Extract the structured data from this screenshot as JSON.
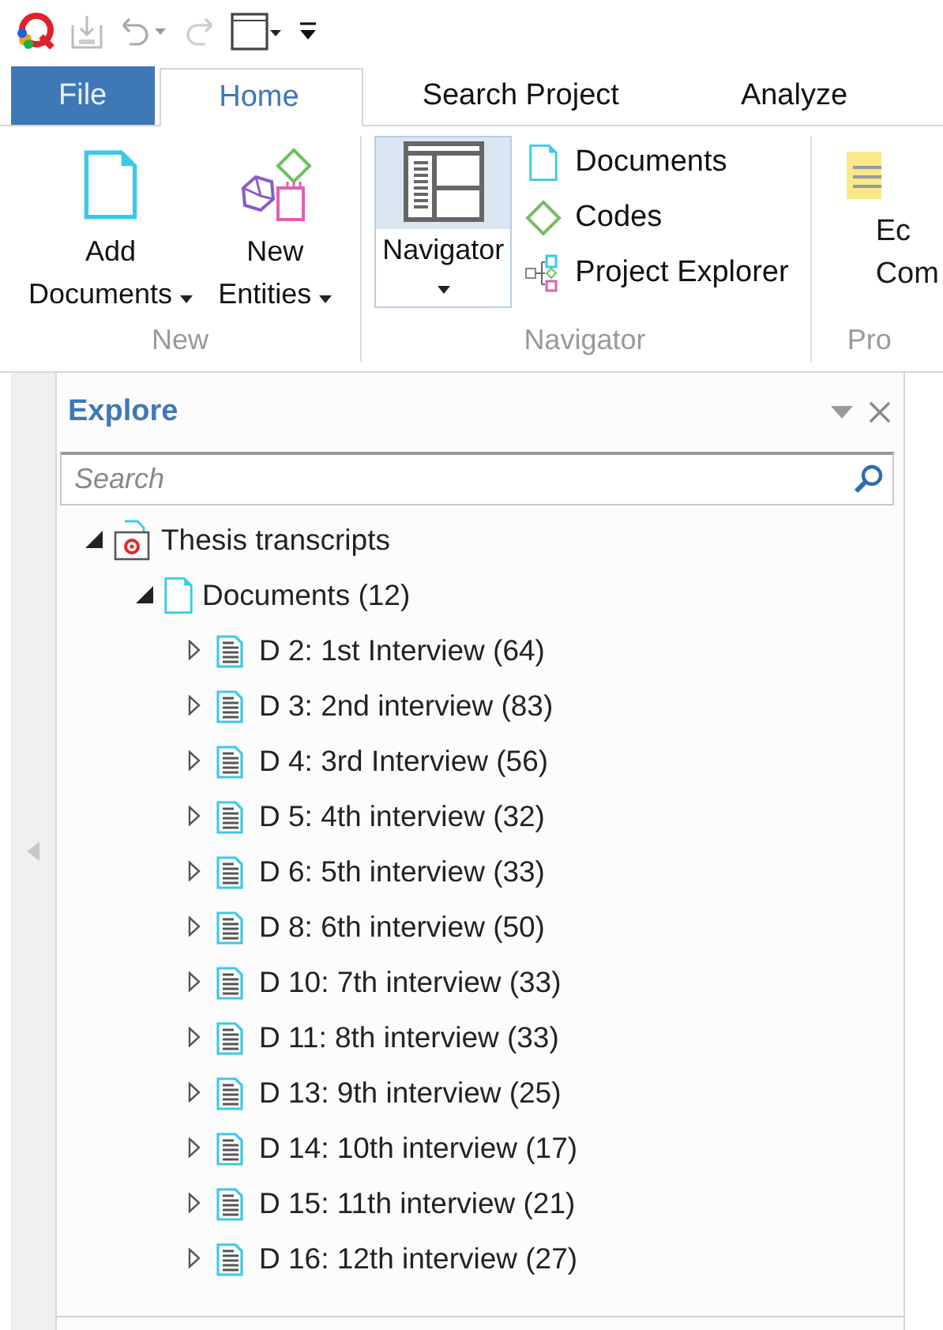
{
  "ribbon_tabs": [
    {
      "label": "File",
      "kind": "file",
      "selected": false
    },
    {
      "label": "Home",
      "kind": "tab",
      "selected": true
    },
    {
      "label": "Search Project",
      "kind": "tab",
      "selected": false
    },
    {
      "label": "Analyze",
      "kind": "tab",
      "selected": false
    }
  ],
  "ribbon_groups": [
    {
      "label": "New",
      "kind": "large",
      "buttons": [
        {
          "kind": "document",
          "lines": [
            "Add",
            "Documents"
          ],
          "dropdown": true
        },
        {
          "kind": "entities",
          "lines": [
            "New",
            "Entities"
          ],
          "dropdown": true
        }
      ]
    },
    {
      "label": "Navigator",
      "kind": "navigator",
      "main": {
        "label": "Navigator",
        "pressed": true
      },
      "items": [
        {
          "kind": "document",
          "label": "Documents"
        },
        {
          "kind": "code",
          "label": "Codes"
        },
        {
          "kind": "explorer",
          "label": "Project Explorer"
        }
      ]
    },
    {
      "label": "Pro",
      "kind": "clipped",
      "lines": [
        "Ec",
        "Com"
      ]
    }
  ],
  "explore": {
    "title": "Explore",
    "search": {
      "placeholder": "Search"
    },
    "tree": [
      {
        "kind": "project",
        "label": "Thesis transcripts",
        "expanded": true,
        "children": [
          {
            "kind": "folder",
            "label": "Documents (12)",
            "expanded": true,
            "children": [
              {
                "kind": "doc",
                "label": "D 2: 1st Interview (64)",
                "expanded": false
              },
              {
                "kind": "doc",
                "label": "D 3: 2nd interview (83)",
                "expanded": false
              },
              {
                "kind": "doc",
                "label": "D 4: 3rd Interview (56)",
                "expanded": false
              },
              {
                "kind": "doc",
                "label": "D 5: 4th interview (32)",
                "expanded": false
              },
              {
                "kind": "doc",
                "label": "D 6: 5th interview (33)",
                "expanded": false
              },
              {
                "kind": "doc",
                "label": "D 8: 6th interview (50)",
                "expanded": false
              },
              {
                "kind": "doc",
                "label": "D 10: 7th interview (33)",
                "expanded": false
              },
              {
                "kind": "doc",
                "label": "D 11: 8th interview (33)",
                "expanded": false
              },
              {
                "kind": "doc",
                "label": "D 13: 9th interview (25)",
                "expanded": false
              },
              {
                "kind": "doc",
                "label": "D 14: 10th interview (17)",
                "expanded": false
              },
              {
                "kind": "doc",
                "label": "D 15: 11th interview (21)",
                "expanded": false
              },
              {
                "kind": "doc",
                "label": "D 16: 12th interview (27)",
                "expanded": false
              }
            ]
          }
        ]
      }
    ]
  }
}
